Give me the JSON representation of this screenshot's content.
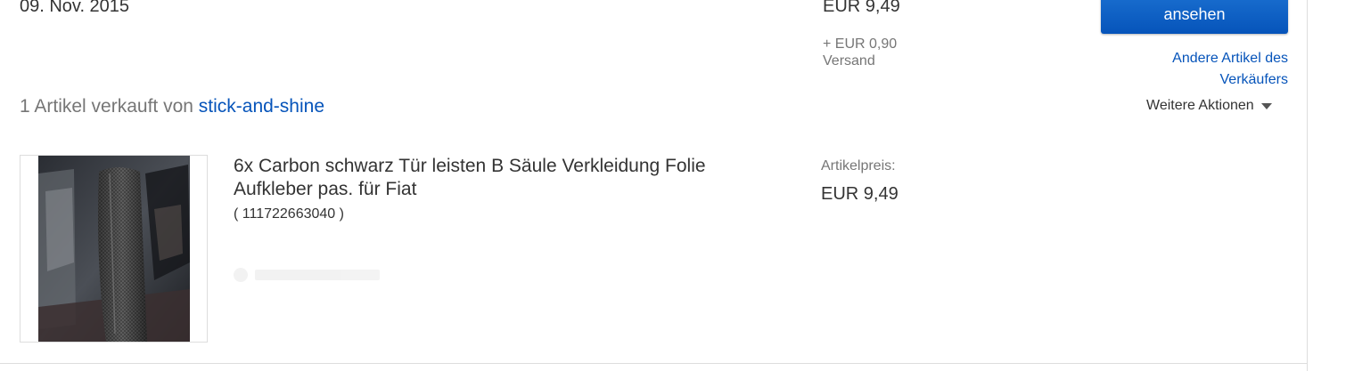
{
  "order": {
    "date": "09. Nov. 2015",
    "total": "EUR 9,49",
    "shipping_amount": "+ EUR 0,90",
    "shipping_label": "Versand",
    "view_button_label": "ansehen",
    "other_items_link": "Andere Artikel des Verkäufers"
  },
  "seller": {
    "prefix": "1 Artikel verkauft von",
    "name": "stick-and-shine"
  },
  "actions": {
    "more_label": "Weitere Aktionen",
    "more_icon": "chevron-down-icon"
  },
  "item": {
    "title": "6x Carbon schwarz Tür leisten B Säule Verkleidung Folie Aufkleber pas. für Fiat",
    "number": "( 111722663040 )",
    "price_label": "Artikelpreis:",
    "price": "EUR 9,49",
    "thumbnail": "product-photo-carbon-pillar-trim"
  },
  "colors": {
    "link": "#0654ba",
    "button": "#0654ba",
    "text": "#333333",
    "muted": "#767676"
  }
}
